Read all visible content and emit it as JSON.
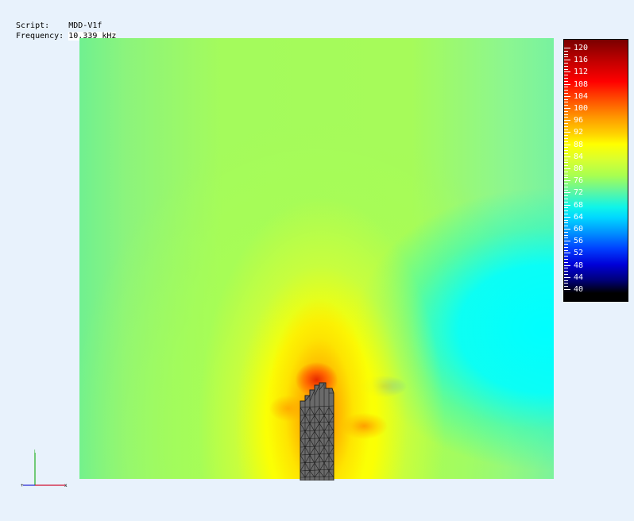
{
  "info": {
    "script_label": "Script:",
    "script_value": "MDD-V1f",
    "frequency_label": "Frequency:",
    "frequency_value": "10.339 kHz"
  },
  "legend": {
    "ticks": [
      "120",
      "116",
      "112",
      "108",
      "104",
      "100",
      "96",
      "92",
      "88",
      "84",
      "80",
      "76",
      "72",
      "68",
      "64",
      "60",
      "56",
      "52",
      "48",
      "44",
      "40"
    ]
  },
  "axes_triad": {
    "x_color": "#d01030",
    "y_color": "#20b020",
    "z_color": "#2020d0"
  }
}
